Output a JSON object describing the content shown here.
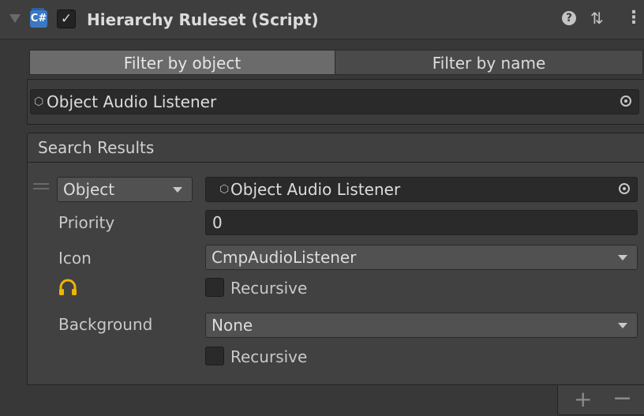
{
  "header": {
    "title": "Hierarchy Ruleset (Script)",
    "script_icon_glyph": "C#",
    "enabled_check": "✓",
    "help_glyph": "?",
    "preset_glyph": "⇅",
    "menu_glyph": "⋮"
  },
  "tabs": [
    {
      "label": "Filter by object",
      "selected": true
    },
    {
      "label": "Filter by name",
      "selected": false
    }
  ],
  "filter": {
    "object_field_value": "Object Audio Listener",
    "object_glyph": "⬡"
  },
  "results": {
    "header": "Search Results",
    "item": {
      "type_dropdown": "Object",
      "object_field_value": "Object Audio Listener",
      "priority_label": "Priority",
      "priority_value": "0",
      "icon_label": "Icon",
      "icon_dropdown": "CmpAudioListener",
      "icon_recursive_label": "Recursive",
      "icon_recursive_checked": false,
      "background_label": "Background",
      "background_dropdown": "None",
      "background_recursive_label": "Recursive",
      "background_recursive_checked": false
    }
  },
  "footer": {
    "add_glyph": "+",
    "remove_glyph": "−"
  },
  "colors": {
    "accent_icon": "#f0b400",
    "script_icon": "#3a78c4",
    "selected_tab": "#6b6b6b"
  }
}
